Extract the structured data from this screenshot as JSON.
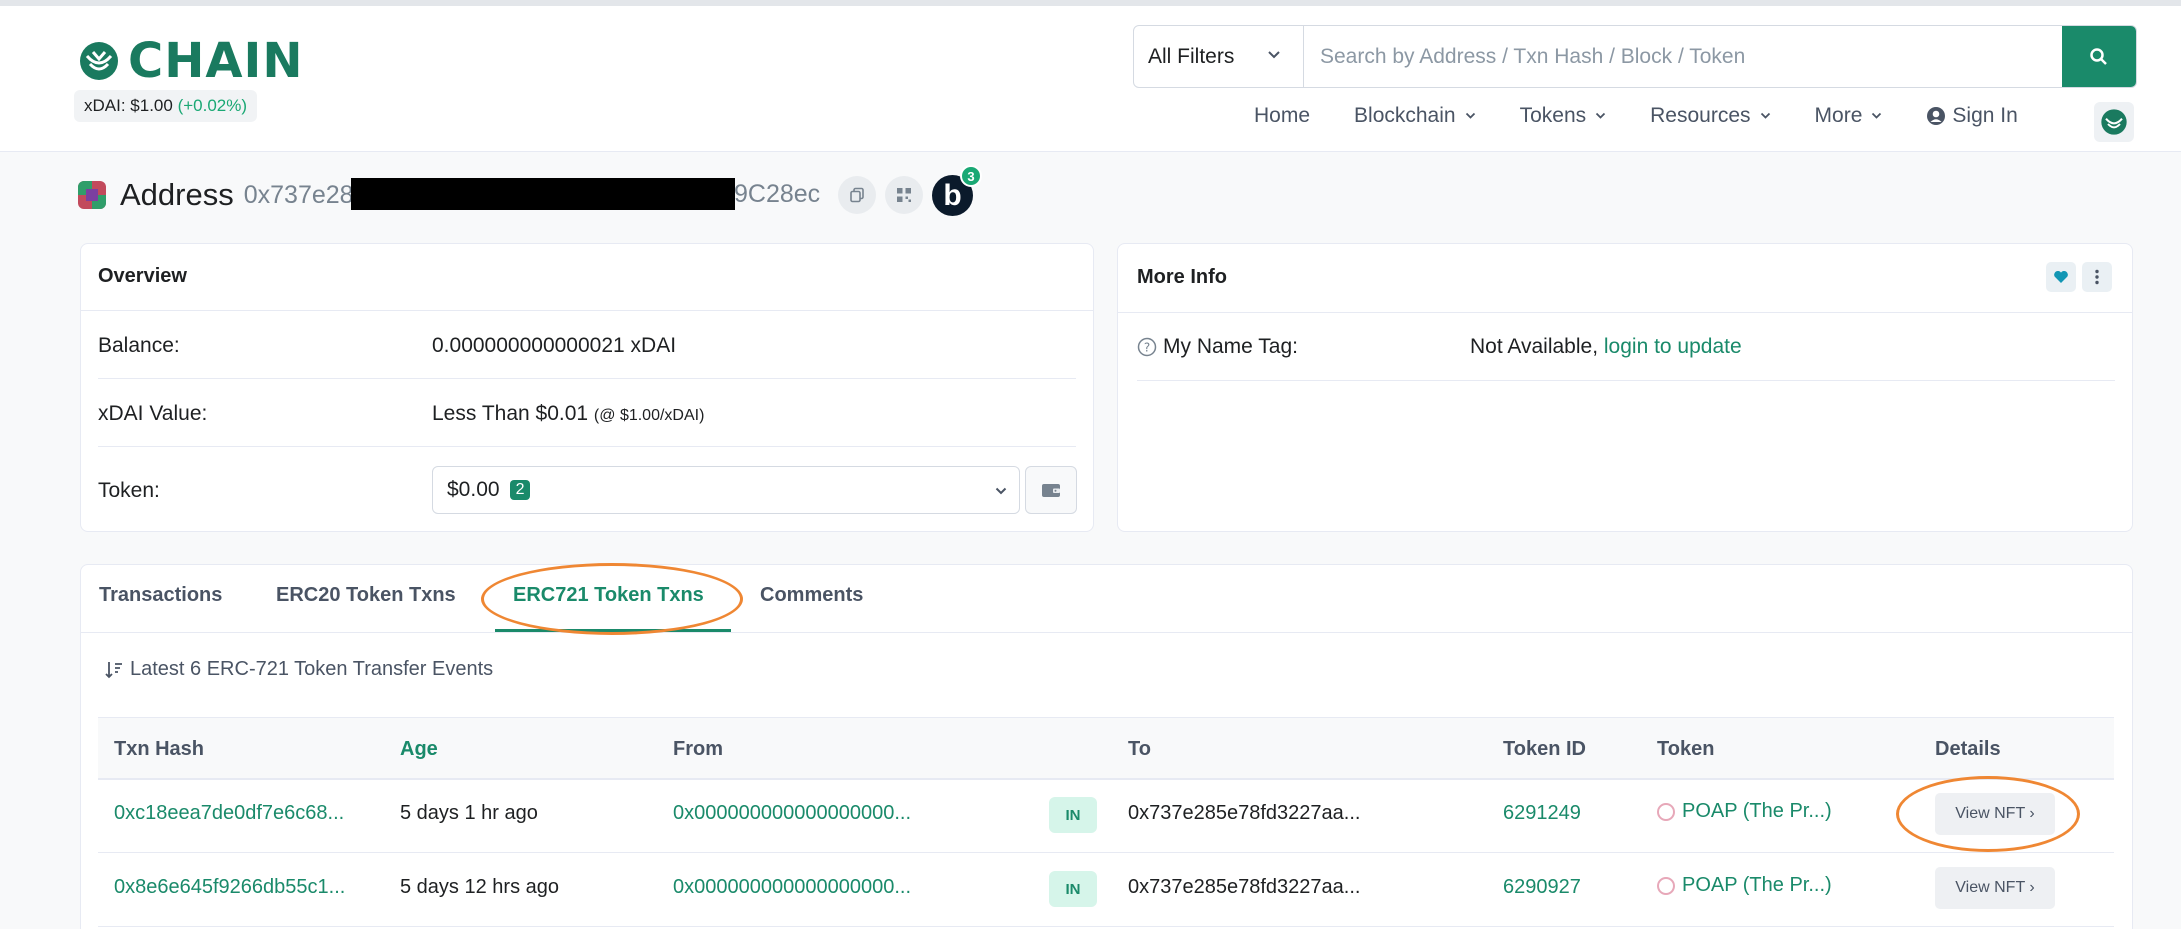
{
  "brand": {
    "name": "CHAIN",
    "price_label": "xDAI: $1.00",
    "price_change": "(+0.02%)"
  },
  "search": {
    "filter_label": "All Filters",
    "placeholder": "Search by Address / Txn Hash / Block / Token"
  },
  "nav": {
    "home": "Home",
    "blockchain": "Blockchain",
    "tokens": "Tokens",
    "resources": "Resources",
    "more": "More",
    "sign_in": "Sign In"
  },
  "address": {
    "label": "Address",
    "hash_start": "0x737e28",
    "hash_end": "9C28ec",
    "badge_letter": "b",
    "badge_count": "3"
  },
  "overview": {
    "title": "Overview",
    "balance_label": "Balance:",
    "balance_value": "0.000000000000021 xDAI",
    "value_label": "xDAI Value:",
    "value_value": "Less Than $0.01",
    "value_note": "(@ $1.00/xDAI)",
    "token_label": "Token:",
    "token_value": "$0.00",
    "token_count": "2"
  },
  "more_info": {
    "title": "More Info",
    "name_tag_label": "My Name Tag:",
    "name_tag_value": "Not Available,",
    "name_tag_link": "login to update"
  },
  "tabs": {
    "t1": "Transactions",
    "t2": "ERC20 Token Txns",
    "t3": "ERC721 Token Txns",
    "t4": "Comments"
  },
  "events": {
    "summary": "Latest 6 ERC-721 Token Transfer Events"
  },
  "table": {
    "headers": {
      "hash": "Txn Hash",
      "age": "Age",
      "from": "From",
      "to": "To",
      "token_id": "Token ID",
      "token": "Token",
      "details": "Details"
    },
    "rows": [
      {
        "hash": "0xc18eea7de0df7e6c68...",
        "age": "5 days 1 hr ago",
        "from": "0x000000000000000000...",
        "dir": "IN",
        "to": "0x737e285e78fd3227aa...",
        "token_id": "6291249",
        "token": "POAP (The Pr...)",
        "details": "View NFT ›"
      },
      {
        "hash": "0x8e6e645f9266db55c1...",
        "age": "5 days 12 hrs ago",
        "from": "0x000000000000000000...",
        "dir": "IN",
        "to": "0x737e285e78fd3227aa...",
        "token_id": "6290927",
        "token": "POAP (The Pr...)",
        "details": "View NFT ›"
      }
    ]
  },
  "colors": {
    "accent": "#1a8a6a",
    "annotation": "#ef8733"
  }
}
